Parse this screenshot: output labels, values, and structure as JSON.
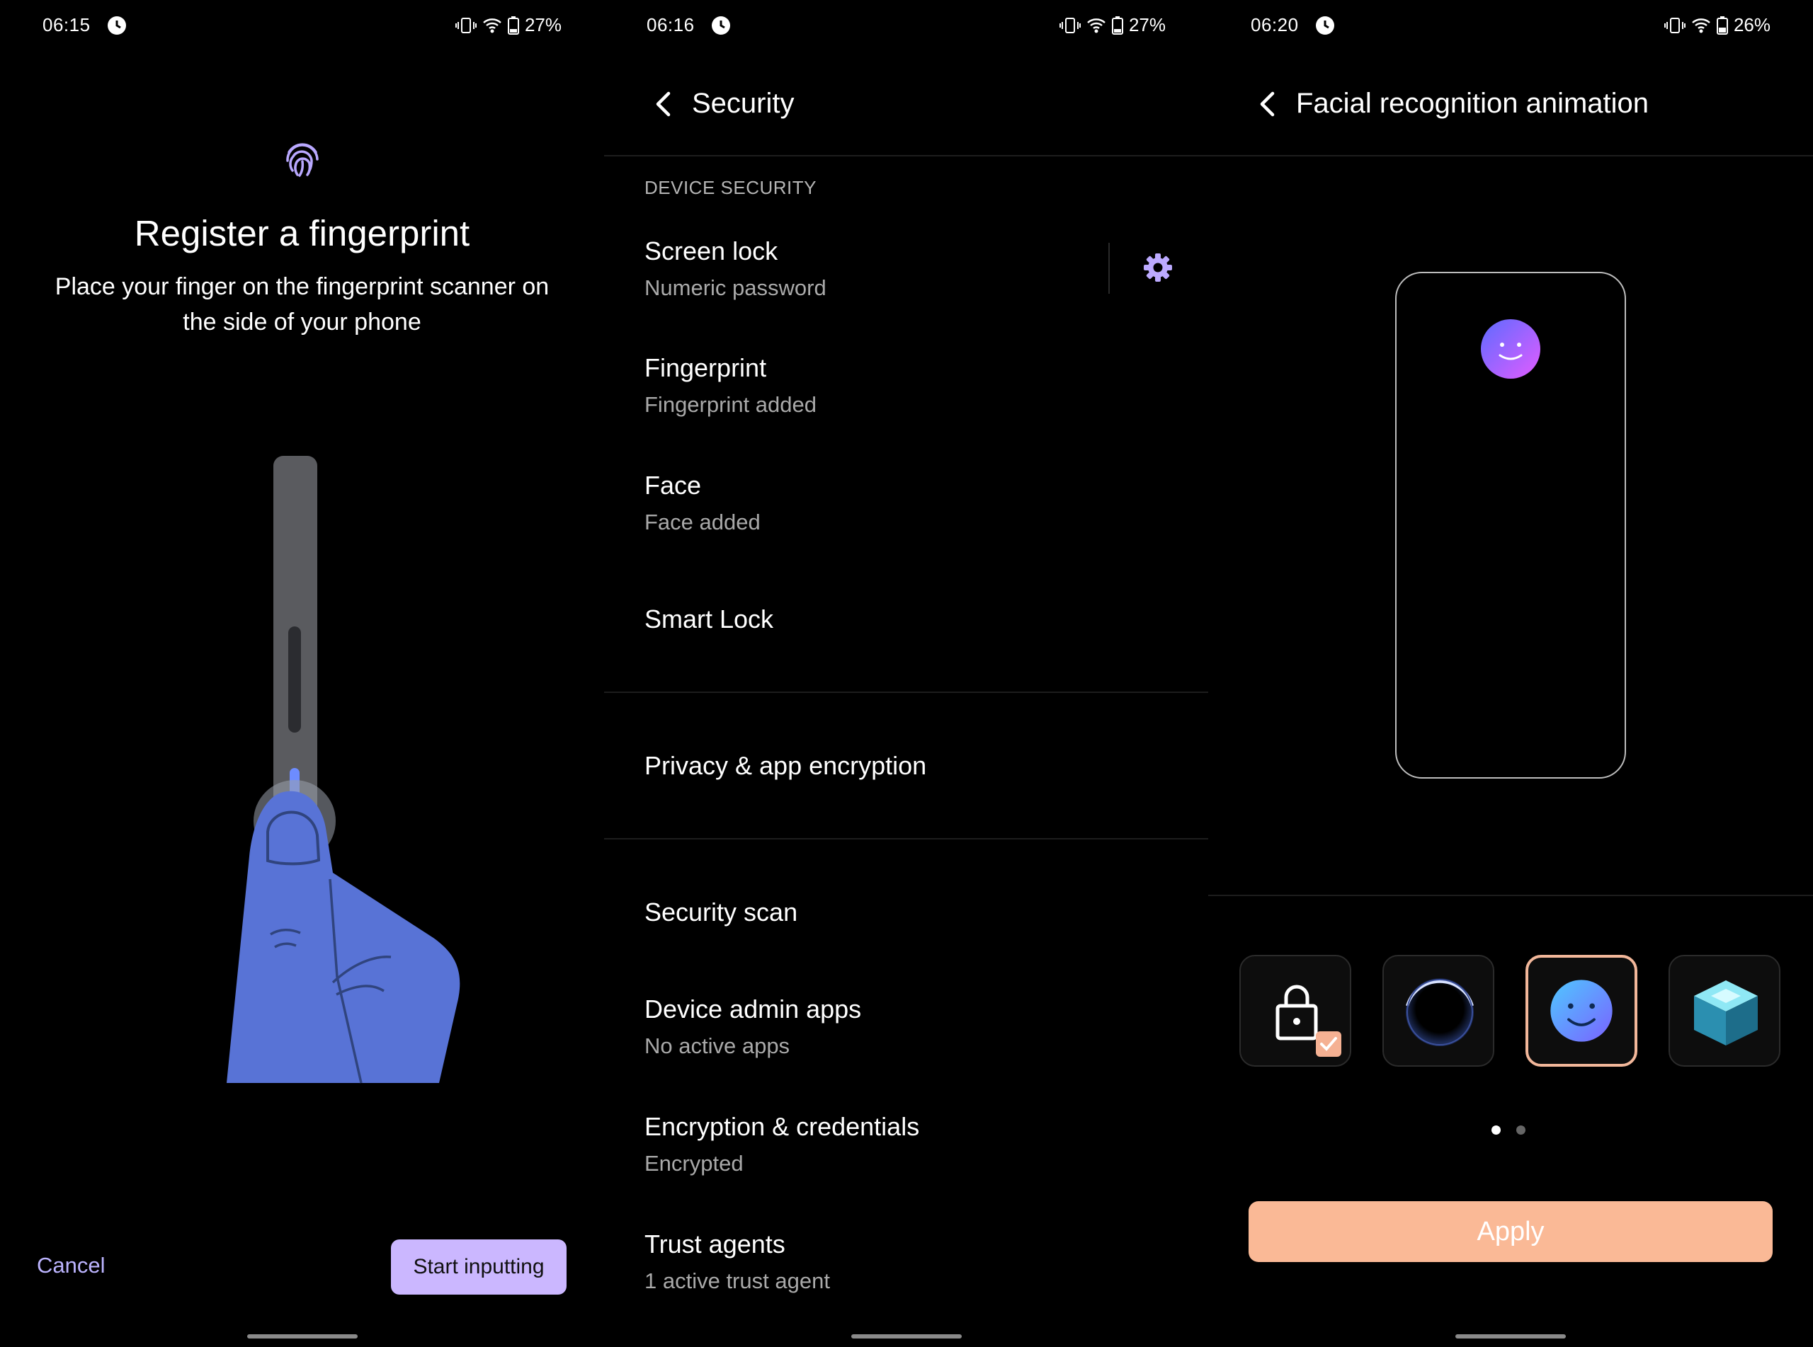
{
  "screens": [
    {
      "status": {
        "time": "06:15",
        "battery": "27%"
      },
      "title": "Register a fingerprint",
      "description": "Place your finger on the fingerprint scanner on the side of your phone",
      "cancel_label": "Cancel",
      "start_label": "Start inputting"
    },
    {
      "status": {
        "time": "06:16",
        "battery": "27%"
      },
      "title": "Security",
      "section_header": "DEVICE SECURITY",
      "items": [
        {
          "title": "Screen lock",
          "subtitle": "Numeric password"
        },
        {
          "title": "Fingerprint",
          "subtitle": "Fingerprint added"
        },
        {
          "title": "Face",
          "subtitle": "Face added"
        },
        {
          "title": "Smart Lock"
        },
        {
          "title": "Privacy & app encryption"
        },
        {
          "title": "Security scan"
        },
        {
          "title": "Device admin apps",
          "subtitle": "No active apps"
        },
        {
          "title": "Encryption & credentials",
          "subtitle": "Encrypted"
        },
        {
          "title": "Trust agents",
          "subtitle": "1 active trust agent"
        }
      ]
    },
    {
      "status": {
        "time": "06:20",
        "battery": "26%"
      },
      "title": "Facial recognition animation",
      "options": [
        {
          "icon": "padlock-icon",
          "badge": "checked"
        },
        {
          "icon": "ring-icon"
        },
        {
          "icon": "smiley-icon",
          "selected": true
        },
        {
          "icon": "cube-icon"
        }
      ],
      "page_indicator": {
        "pages": 2,
        "current": 1
      },
      "apply_label": "Apply"
    }
  ],
  "colors": {
    "accent_purple": "#cbb7ff",
    "apply_peach": "#fab996",
    "selected_border": "#f2b79a"
  }
}
